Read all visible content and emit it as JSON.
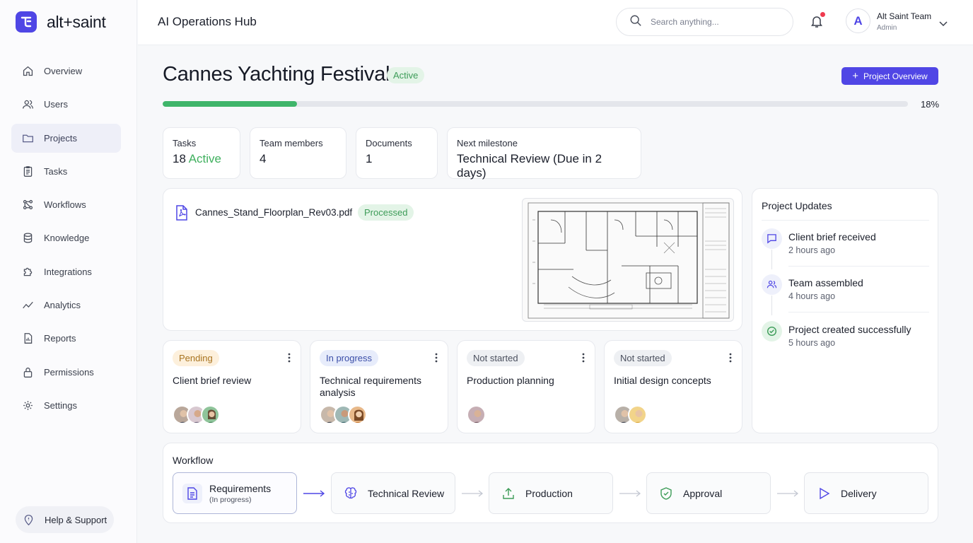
{
  "brand": {
    "name": "alt+saint",
    "accent": "#4f46e5"
  },
  "sidebar": {
    "items": [
      {
        "label": "Overview",
        "icon": "home-icon"
      },
      {
        "label": "Users",
        "icon": "users-icon"
      },
      {
        "label": "Projects",
        "icon": "folder-icon",
        "active": true
      },
      {
        "label": "Tasks",
        "icon": "clipboard-icon"
      },
      {
        "label": "Workflows",
        "icon": "workflow-icon"
      },
      {
        "label": "Knowledge",
        "icon": "database-icon"
      },
      {
        "label": "Integrations",
        "icon": "puzzle-icon"
      },
      {
        "label": "Analytics",
        "icon": "analytics-icon"
      },
      {
        "label": "Reports",
        "icon": "report-icon"
      },
      {
        "label": "Permissions",
        "icon": "lock-icon"
      },
      {
        "label": "Settings",
        "icon": "gear-icon"
      }
    ],
    "help_label": "Help & Support"
  },
  "header": {
    "title": "AI Operations Hub",
    "search_placeholder": "Search anything...",
    "user": {
      "initial": "A",
      "name": "Alt Saint Team",
      "role": "Admin"
    }
  },
  "project": {
    "title": "Cannes Yachting Festival",
    "status": "Active",
    "overview_button": "Project Overview",
    "progress": 18,
    "progress_label": "18%"
  },
  "stats": {
    "tasks": {
      "label": "Tasks",
      "count": "18",
      "suffix": "Active"
    },
    "team": {
      "label": "Team members",
      "value": "4"
    },
    "documents": {
      "label": "Documents",
      "value": "1"
    },
    "milestone": {
      "label": "Next milestone",
      "value": "Technical Review (Due in 2 days)"
    }
  },
  "document": {
    "filename": "Cannes_Stand_Floorplan_Rev03.pdf",
    "status": "Processed"
  },
  "updates": {
    "title": "Project Updates",
    "items": [
      {
        "title": "Client brief received",
        "time": "2 hours ago",
        "icon": "message-icon"
      },
      {
        "title": "Team assembled",
        "time": "4 hours ago",
        "icon": "team-icon"
      },
      {
        "title": "Project created successfully",
        "time": "5 hours ago",
        "icon": "check-circle-icon"
      }
    ]
  },
  "tasks": [
    {
      "status": "Pending",
      "title": "Client brief review",
      "avatars": 3
    },
    {
      "status": "In progress",
      "title": "Technical requirements analysis",
      "avatars": 3
    },
    {
      "status": "Not started",
      "title": "Production planning",
      "avatars": 1
    },
    {
      "status": "Not started",
      "title": "Initial design concepts",
      "avatars": 2
    }
  ],
  "workflow": {
    "title": "Workflow",
    "steps": [
      {
        "label": "Requirements",
        "sub": "(In progress)",
        "icon": "document-icon"
      },
      {
        "label": "Technical Review",
        "icon": "brain-icon"
      },
      {
        "label": "Production",
        "icon": "upload-icon"
      },
      {
        "label": "Approval",
        "icon": "shield-check-icon"
      },
      {
        "label": "Delivery",
        "icon": "play-icon"
      }
    ]
  },
  "colors": {
    "green": "#3fb56a",
    "primary": "#5046e5"
  }
}
